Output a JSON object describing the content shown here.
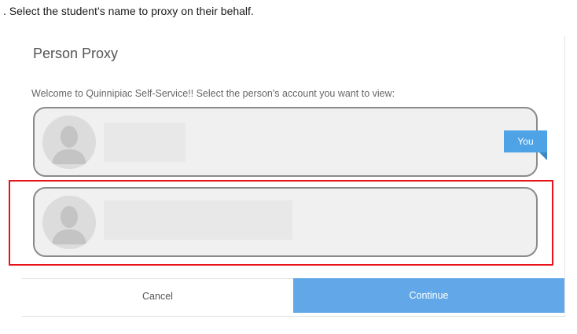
{
  "instruction": ". Select the student’s name to proxy on their behalf.",
  "dialog": {
    "title": "Person Proxy",
    "welcome": "Welcome to Quinnipiac Self-Service!! Select the person's account you want to view:",
    "accounts": [
      {
        "badge": "You",
        "selected": false
      },
      {
        "badge": "",
        "selected": true
      }
    ],
    "cancel_label": "Cancel",
    "continue_label": "Continue"
  },
  "colors": {
    "accent": "#62a8e8",
    "badge": "#4da3e6",
    "highlight": "#e8131a",
    "card_bg": "#f0f0f0",
    "card_border": "#8a8a8a"
  }
}
